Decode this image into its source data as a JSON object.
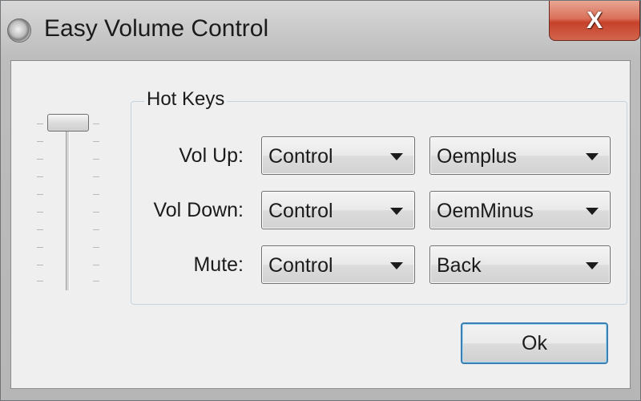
{
  "window": {
    "title": "Easy Volume Control",
    "close_label": "X"
  },
  "slider": {
    "level": 1.0
  },
  "hotkeys": {
    "group_label": "Hot Keys",
    "rows": [
      {
        "label": "Vol Up:",
        "modifier": "Control",
        "key": "Oemplus"
      },
      {
        "label": "Vol Down:",
        "modifier": "Control",
        "key": "OemMinus"
      },
      {
        "label": "Mute:",
        "modifier": "Control",
        "key": "Back"
      }
    ]
  },
  "buttons": {
    "ok_label": "Ok"
  },
  "colors": {
    "close_button": "#c7412a",
    "focus_border": "#3c7fb1"
  }
}
